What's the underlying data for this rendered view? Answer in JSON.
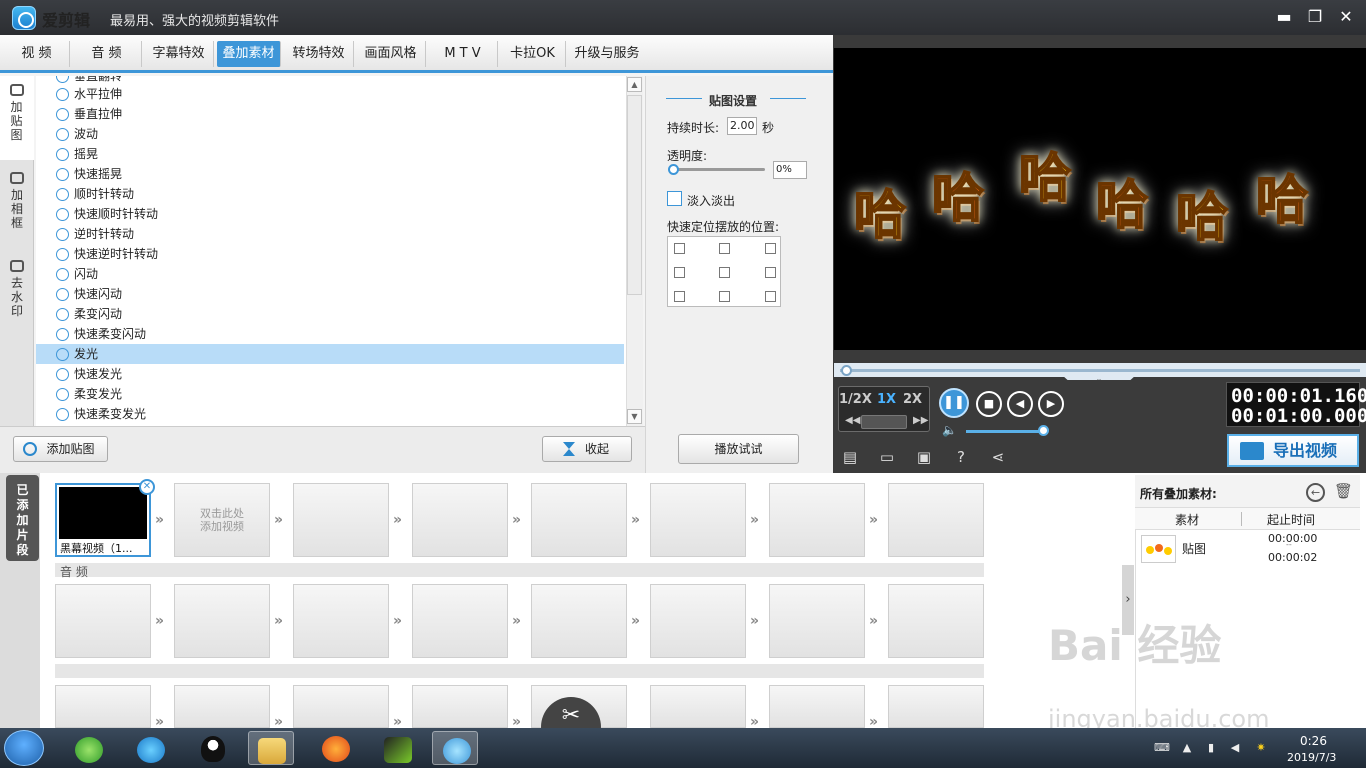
{
  "window": {
    "title": "爱剪辑",
    "slogan": "最易用、强大的视频剪辑软件",
    "minimize": "▬",
    "maximize": "❐",
    "close": "✕"
  },
  "tabs": [
    "视  频",
    "音  频",
    "字幕特效",
    "叠加素材",
    "转场特效",
    "画面风格",
    "M T V",
    "卡拉OK",
    "升级与服务"
  ],
  "active_tab": "叠加素材",
  "side_tabs": [
    "加贴图",
    "加相框",
    "去水印"
  ],
  "effects_list": [
    "垂直翻转",
    "水平拉伸",
    "垂直拉伸",
    "波动",
    "摇晃",
    "快速摇晃",
    "顺时针转动",
    "快速顺时针转动",
    "逆时针转动",
    "快速逆时针转动",
    "闪动",
    "快速闪动",
    "柔变闪动",
    "快速柔变闪动",
    "发光",
    "快速发光",
    "柔变发光",
    "快速柔变发光"
  ],
  "selected_effect": "发光",
  "buttons": {
    "add_sticker": "添加贴图",
    "collapse": "收起",
    "preview_test": "播放试试",
    "export": "导出视频"
  },
  "sticker_settings": {
    "title": "贴图设置",
    "duration_label": "持续时长:",
    "duration_value": "2.00",
    "duration_unit": "秒",
    "opacity_label": "透明度:",
    "opacity_value": "0%",
    "fade_label": "淡入淡出",
    "position_label": "快速定位摆放的位置:"
  },
  "preview": {
    "overlay_text": [
      "哈",
      "哈",
      "哈",
      "哈",
      "哈",
      "哈"
    ],
    "speed_options": [
      "1/2X",
      "1X",
      "2X"
    ],
    "active_speed": "1X",
    "current_time": "00:00:01.160",
    "total_time": "00:01:00.000",
    "volume": 0.77,
    "progress": 0.02
  },
  "timeline": {
    "added_label": "已添加片段",
    "clip_name": "黑幕视频（1...",
    "dbl_hint_line1": "双击此处",
    "dbl_hint_line2": "添加视频",
    "audio_label": "音  频"
  },
  "overlay_panel": {
    "title": "所有叠加素材:",
    "col_material": "素材",
    "col_time": "起止时间",
    "item_name": "贴图",
    "item_start": "00:00:00",
    "item_end": "00:00:02",
    "item_mid": "--"
  },
  "taskbar": {
    "time": "0:26",
    "date": "2019/7/3"
  },
  "watermark": {
    "brand": "Bai 经验",
    "url": "jingyan.baidu.com"
  }
}
